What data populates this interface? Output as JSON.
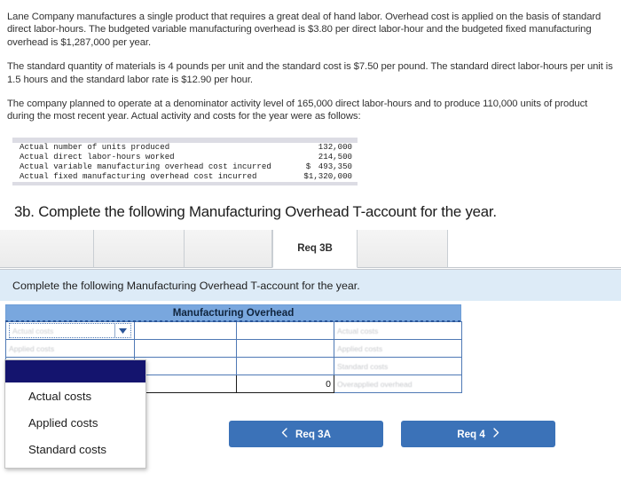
{
  "problem": {
    "paragraphs": [
      "Lane Company manufactures a single product that requires a great deal of hand labor. Overhead cost is applied on the basis of standard direct labor-hours. The budgeted variable manufacturing overhead is $3.80 per direct labor-hour and the budgeted fixed manufacturing overhead is $1,287,000 per year.",
      "The standard quantity of materials is 4 pounds per unit and the standard cost is $7.50 per pound. The standard direct labor-hours per unit is 1.5 hours and the standard labor rate is $12.90 per hour.",
      "The company planned to operate at a denominator activity level of 165,000 direct labor-hours and to produce 110,000 units of product during the most recent year. Actual activity and costs for the year were as follows:"
    ]
  },
  "data_table": {
    "rows": [
      {
        "label": "Actual number of units produced",
        "currency": "",
        "value": "132,000"
      },
      {
        "label": "Actual direct labor-hours worked",
        "currency": "",
        "value": "214,500"
      },
      {
        "label": "Actual variable manufacturing overhead cost incurred",
        "currency": "$",
        "value": "493,350"
      },
      {
        "label": "Actual fixed manufacturing overhead cost incurred",
        "currency": "",
        "value": "$1,320,000"
      }
    ]
  },
  "question_heading": "3b. Complete the following Manufacturing Overhead T-account for the year.",
  "tabs": [
    {
      "label": "",
      "active": false
    },
    {
      "label": "",
      "active": false
    },
    {
      "label": "",
      "active": false
    },
    {
      "label": "Req 3B",
      "active": true
    },
    {
      "label": "",
      "active": false
    }
  ],
  "instruction": "Complete the following Manufacturing Overhead T-account for the year.",
  "taccount": {
    "title": "Manufacturing Overhead",
    "combo_value": "Actual costs",
    "rows": [
      {
        "a": "",
        "b": "",
        "c": "",
        "d": "Actual costs"
      },
      {
        "a": "Applied costs",
        "b": "",
        "c": "",
        "d": "Applied costs"
      },
      {
        "a": "",
        "b": "",
        "c": "",
        "d": "Standard costs"
      },
      {
        "a": "",
        "b": "",
        "c": "0",
        "d": "Overapplied overhead"
      }
    ]
  },
  "dropdown": {
    "options": [
      {
        "label": "",
        "selected": true
      },
      {
        "label": "Actual costs",
        "selected": false
      },
      {
        "label": "Applied costs",
        "selected": false
      },
      {
        "label": "Standard costs",
        "selected": false
      }
    ]
  },
  "nav": {
    "prev_label": "Req 3A",
    "next_label": "Req 4"
  },
  "colors": {
    "instruction_bar": "#ddebf7",
    "taccount_header": "#79a7de",
    "button_blue": "#3b72b8",
    "dropdown_highlight": "#14146e",
    "grid_border": "#4f79b5"
  }
}
